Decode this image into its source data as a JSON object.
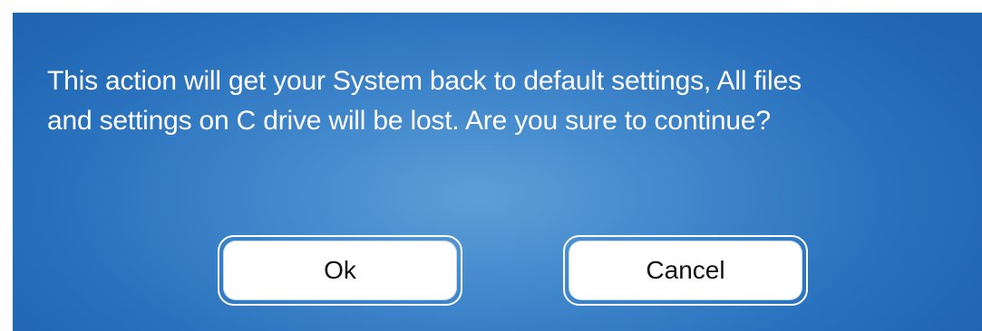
{
  "dialog": {
    "message_line1": "This action will get your System back to default settings, All files",
    "message_line2": "and settings on C drive will be lost. Are you sure to continue?",
    "ok_label": "Ok",
    "cancel_label": "Cancel"
  },
  "colors": {
    "dialog_background": "#3f86cb",
    "button_background": "#ffffff",
    "text_on_dialog": "#ffffff"
  }
}
